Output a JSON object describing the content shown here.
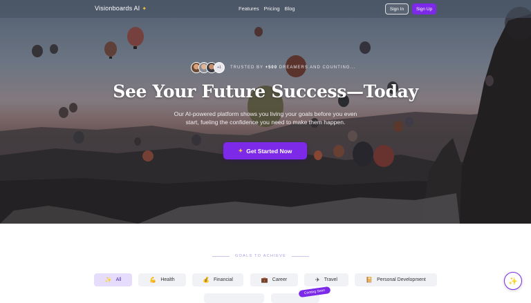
{
  "nav": {
    "brand": "Visionboards AI",
    "brand_icon": "sparkle-icon",
    "links": [
      "Features",
      "Pricing",
      "Blog"
    ],
    "signin_label": "Sign In",
    "signup_label": "Sign Up",
    "accent": "#7c2ae8"
  },
  "hero": {
    "trust_prefix": "TRUSTED BY",
    "trust_count": "+500",
    "trust_suffix": "DREAMERS AND COUNTING...",
    "avatar_more": "+1",
    "headline": "See Your Future Success—Today",
    "subline": "Our AI-powered platform shows you living your goals before you even start, fueling the confidence you need to make them happen.",
    "cta_label": "Get Started Now",
    "cta_icon": "sparkle-icon"
  },
  "goals": {
    "section_label": "GOALS TO ACHIEVE",
    "categories": [
      {
        "label": "All",
        "icon": "sparkle-icon",
        "glyph": "✨"
      },
      {
        "label": "Health",
        "icon": "flexed-arm-icon",
        "glyph": "💪"
      },
      {
        "label": "Financial",
        "icon": "money-bag-icon",
        "glyph": "💰"
      },
      {
        "label": "Career",
        "icon": "briefcase-icon",
        "glyph": "💼"
      },
      {
        "label": "Travel",
        "icon": "airplane-icon",
        "glyph": "✈"
      },
      {
        "label": "Personal Development",
        "icon": "notebook-icon",
        "glyph": "📔"
      }
    ],
    "coming_soon": "Coming Soon"
  },
  "fab_icon": "sparkle-icon"
}
